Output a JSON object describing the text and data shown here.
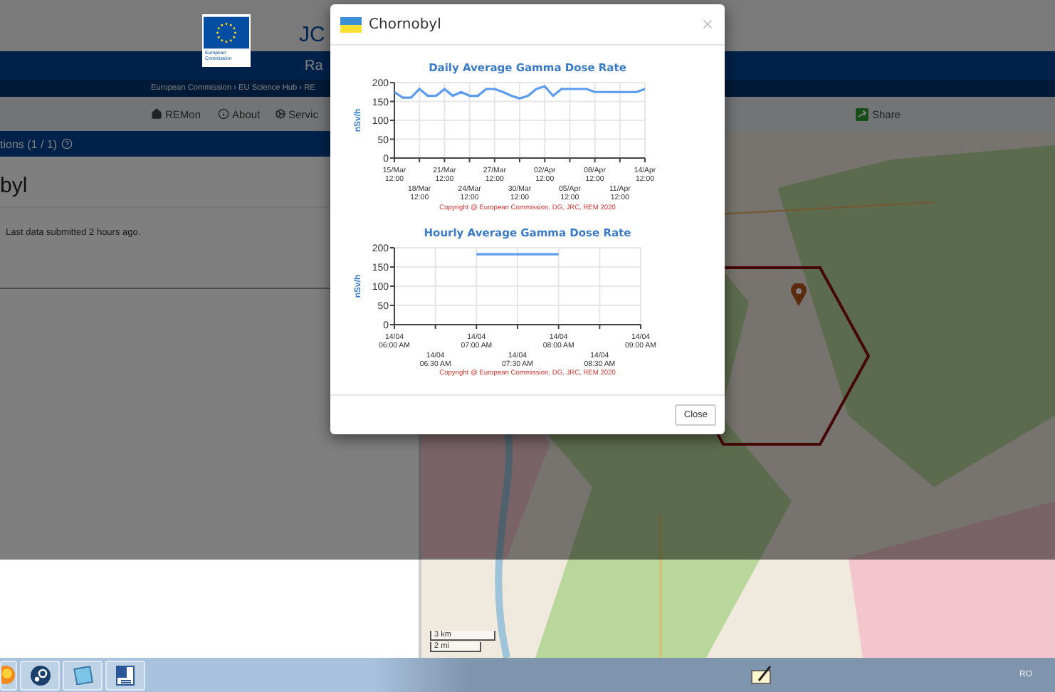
{
  "page": {
    "header": {
      "logo_text": "European Commission",
      "site_title": "JC"
    },
    "blue_bar": {
      "title": "Ra",
      "breadcrumb": "European Commission › EU Science Hub › RE"
    },
    "nav": [
      {
        "label": "REMon",
        "kind": "home"
      },
      {
        "label": "About",
        "kind": "info"
      },
      {
        "label": "Servic",
        "kind": "services"
      },
      {
        "label": "Share",
        "kind": "share"
      }
    ],
    "left_panel": {
      "header": "tions (1 / 1)",
      "station_name": "byl",
      "status": "Last data submitted 2 hours ago."
    },
    "map": {
      "scale": [
        "3 km",
        "2 mi"
      ]
    }
  },
  "modal": {
    "title": "Chornobyl",
    "charts": [
      {
        "chart_data": {
          "type": "line",
          "title": "Daily Average Gamma Dose Rate",
          "ylabel": "nSv/h",
          "categories": [
            "15/Mar 12:00",
            null,
            null,
            "18/Mar 12:00",
            null,
            null,
            "21/Mar 12:00",
            null,
            null,
            "24/Mar 12:00",
            null,
            null,
            "27/Mar 12:00",
            null,
            null,
            "30/Mar 12:00",
            null,
            null,
            "02/Apr 12:00",
            null,
            null,
            "05/Apr 12:00",
            null,
            null,
            "08/Apr 12:00",
            null,
            null,
            "11/Apr 12:00",
            null,
            null,
            "14/Apr 12:00"
          ],
          "ylim": [
            0,
            200
          ],
          "yticks": [
            0,
            50,
            100,
            150,
            200
          ],
          "grid": true,
          "series": [
            {
              "color": "#5b9bf0",
              "values": [
                175,
                160,
                160,
                183,
                165,
                165,
                183,
                165,
                175,
                165,
                165,
                183,
                183,
                175,
                165,
                158,
                165,
                183,
                190,
                165,
                183,
                183,
                183,
                183,
                175,
                175,
                175,
                175,
                175,
                175,
                183
              ]
            }
          ]
        },
        "copyright": "Copyright @ European Commission, DG, JRC, REM 2020"
      },
      {
        "chart_data": {
          "type": "line",
          "title": "Hourly Average Gamma Dose Rate",
          "ylabel": "nSv/h",
          "categories": [
            "14/04 06:00 AM",
            "14/04 06:30 AM",
            "14/04 07:00 AM",
            "14/04 07:30 AM",
            "14/04 08:00 AM",
            "14/04 08:30 AM",
            "14/04 09:00 AM"
          ],
          "ylim": [
            0,
            200
          ],
          "yticks": [
            0,
            50,
            100,
            150,
            200
          ],
          "grid": true,
          "series": [
            {
              "color": "#5b9bf0",
              "values": [
                null,
                null,
                183,
                183,
                183,
                null,
                null
              ]
            }
          ]
        },
        "copyright": "Copyright @ European Commission, DG, JRC, REM 2020"
      }
    ],
    "close_button": "Close"
  },
  "taskbar": {
    "apps": [
      {
        "kind": "browser"
      },
      {
        "kind": "steam"
      },
      {
        "kind": "notes"
      },
      {
        "kind": "word"
      }
    ],
    "tray_app": {
      "kind": "pen"
    },
    "language": "RO"
  }
}
